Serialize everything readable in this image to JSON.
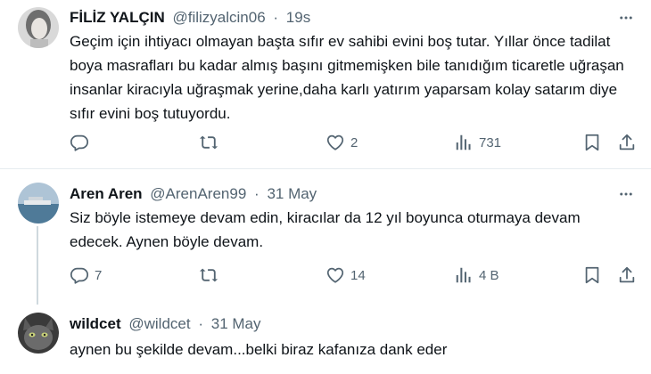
{
  "tweets": [
    {
      "name": "FİLİZ YALÇIN",
      "handle": "@filizyalcin06",
      "sep": "·",
      "time": "19s",
      "text": "Geçim için ihtiyacı olmayan başta sıfır ev sahibi evini boş tutar. Yıllar önce tadilat boya masrafları bu kadar almış başını gitmemişken bile tanıdığım ticaretle uğraşan insanlar kiracıyla uğraşmak yerine,daha karlı yatırım yaparsam kolay satarım diye sıfır evini boş tutuyordu.",
      "replies": "",
      "retweets": "",
      "likes": "2",
      "views": "731"
    },
    {
      "name": "Aren Aren",
      "handle": "@ArenAren99",
      "sep": "·",
      "time": "31 May",
      "text": "Siz böyle istemeye devam edin, kiracılar da 12 yıl boyunca oturmaya devam edecek. Aynen böyle devam.",
      "replies": "7",
      "retweets": "",
      "likes": "14",
      "views": "4 B"
    },
    {
      "name": "wildcet",
      "handle": "@wildcet",
      "sep": "·",
      "time": "31 May",
      "text": "aynen bu şekilde devam...belki biraz kafanıza dank eder"
    }
  ],
  "icons": {
    "more": "more-dots-icon",
    "reply": "reply-icon",
    "retweet": "retweet-icon",
    "like": "heart-icon",
    "views": "views-icon",
    "bookmark": "bookmark-icon",
    "share": "share-icon"
  },
  "colors": {
    "text": "#0f1419",
    "secondary": "#536471",
    "divider": "#e6ecf0"
  }
}
